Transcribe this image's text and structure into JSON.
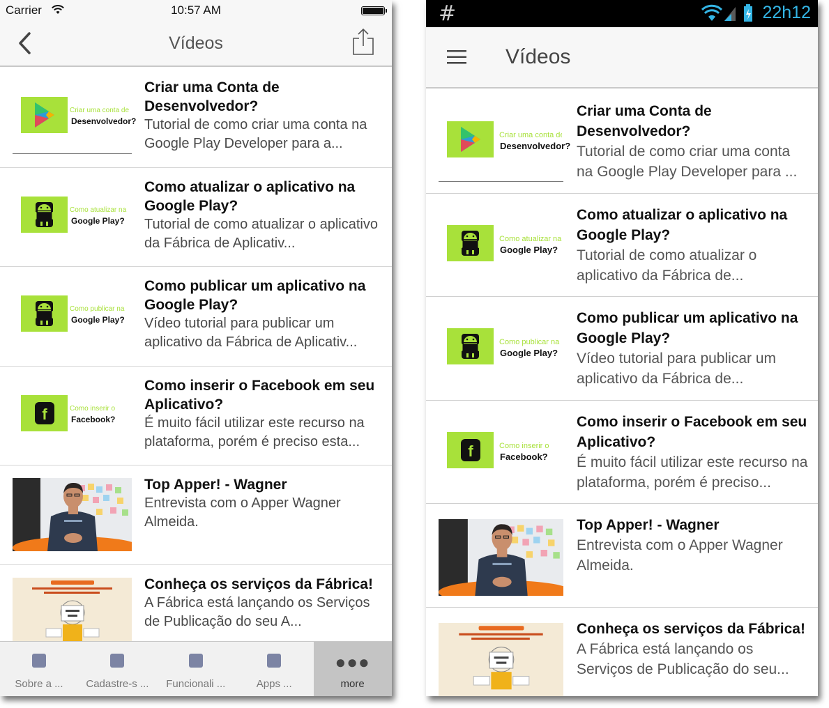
{
  "ios": {
    "status": {
      "carrier": "Carrier",
      "time": "10:57 AM"
    },
    "nav": {
      "title": "Vídeos"
    },
    "tabs": [
      {
        "label": "Sobre a ...",
        "icon": "about-icon"
      },
      {
        "label": "Cadastre-s ...",
        "icon": "register-icon"
      },
      {
        "label": "Funcionali ...",
        "icon": "features-icon"
      },
      {
        "label": "Apps ...",
        "icon": "apps-icon"
      },
      {
        "label": "more",
        "icon": "more-icon"
      }
    ]
  },
  "android": {
    "status": {
      "clock": "22h12"
    },
    "toolbar": {
      "title": "Vídeos"
    }
  },
  "videos": [
    {
      "title": "Criar uma Conta de Desenvolvedor?",
      "desc_ios": "Tutorial de como criar uma conta na Google Play Developer para a...",
      "desc_android": "Tutorial de como criar uma conta na Google Play Developer para ...",
      "thumb": {
        "line1": "Criar uma conta de",
        "line2": "Desenvolvedor?",
        "icon": "google-play-icon"
      }
    },
    {
      "title": "Como atualizar o aplicativo na Google Play?",
      "desc_ios": "Tutorial de como atualizar o aplicativo da Fábrica de Aplicativ...",
      "desc_android": "Tutorial de como atualizar o aplicativo da Fábrica de...",
      "thumb": {
        "line1": "Como atualizar na",
        "line2": "Google Play?",
        "icon": "android-icon"
      }
    },
    {
      "title": "Como publicar um aplicativo na Google Play?",
      "desc_ios": "Vídeo tutorial para publicar um aplicativo da Fábrica de Aplicativ...",
      "desc_android": "Vídeo tutorial para publicar um aplicativo da Fábrica de...",
      "thumb": {
        "line1": "Como publicar na",
        "line2": "Google Play?",
        "icon": "android-icon"
      }
    },
    {
      "title": "Como inserir o Facebook em seu Aplicativo?",
      "desc_ios": "É muito fácil utilizar este recurso na plataforma, porém é preciso esta...",
      "desc_android": "É muito fácil utilizar este recurso na plataforma, porém é preciso...",
      "thumb": {
        "line1": "Como inserir o",
        "line2": "Facebook?",
        "icon": "facebook-icon"
      }
    },
    {
      "title": "Top Apper! - Wagner",
      "desc_ios": "Entrevista com o Apper Wagner Almeida.",
      "desc_android": "Entrevista com o Apper Wagner Almeida.",
      "thumb": {
        "icon": "interview-photo"
      }
    },
    {
      "title": "Conheça os serviços da Fábrica!",
      "desc_ios": "A Fábrica está lançando os Serviços de Publicação do seu A...",
      "desc_android": "A Fábrica está lançando os Serviços de Publicação do seu...",
      "thumb": {
        "icon": "promo-banner"
      }
    }
  ],
  "colors": {
    "thumb_green": "#a8e13a",
    "android_clock": "#34b5e5",
    "ios_bar": "#f7f7f7"
  }
}
